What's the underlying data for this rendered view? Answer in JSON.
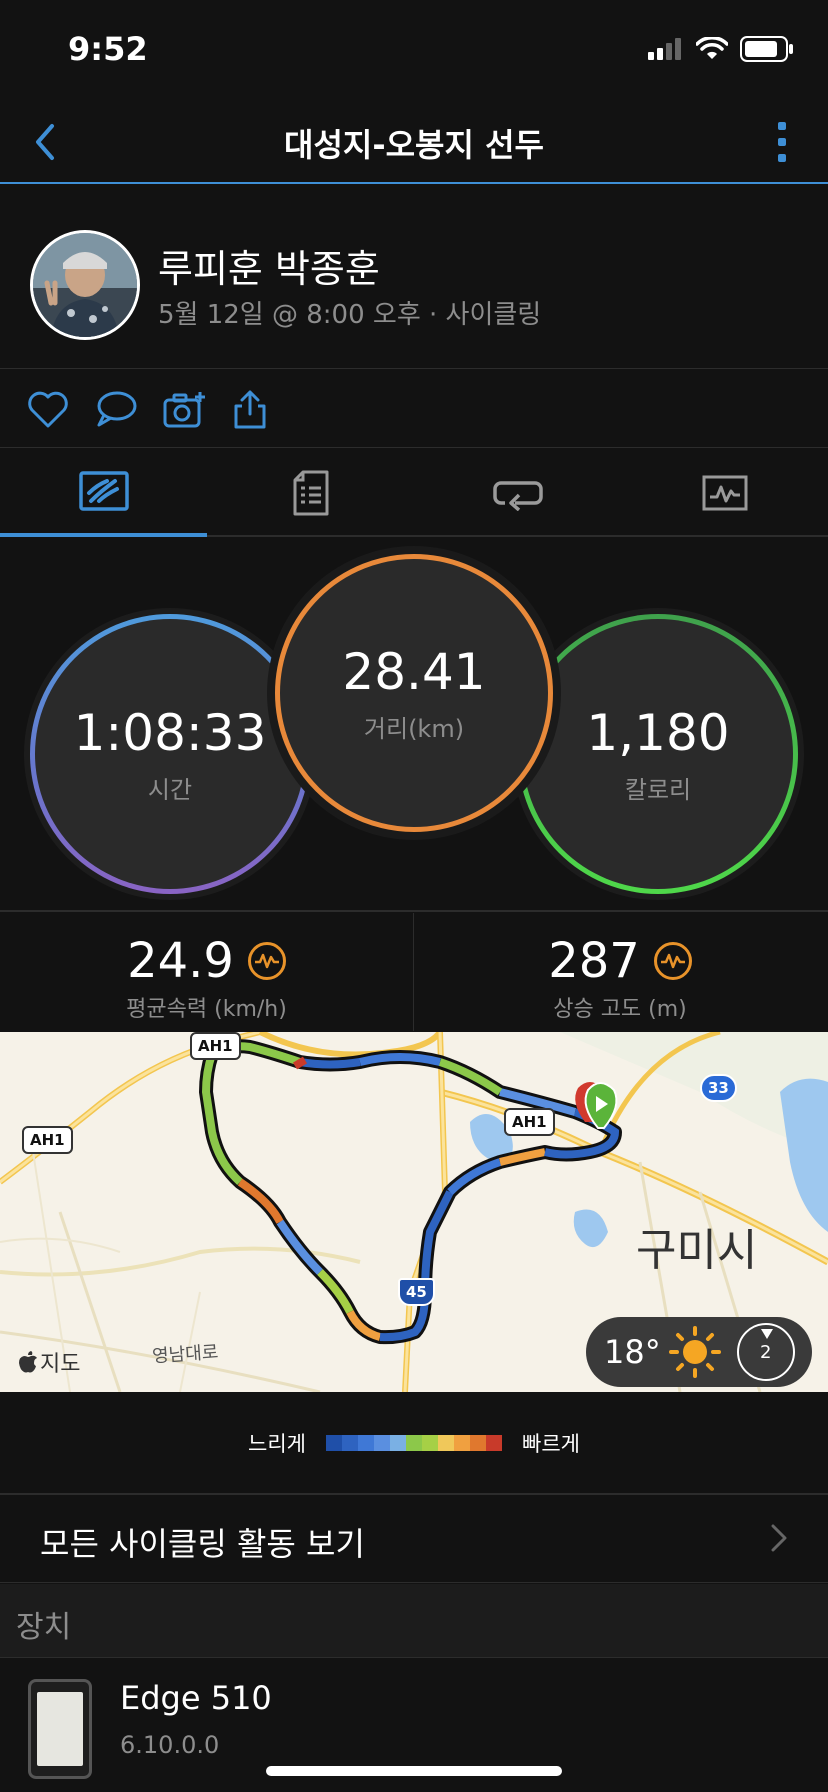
{
  "status": {
    "time": "9:52"
  },
  "nav": {
    "title": "대성지-오봉지 선두"
  },
  "profile": {
    "name": "루피훈 박종훈",
    "subtitle": "5월 12일 @ 8:00 오후 · 사이클링"
  },
  "actions": [
    "like-icon",
    "comment-icon",
    "camera-icon",
    "share-icon"
  ],
  "tabs": [
    {
      "icon": "cycling-summary-icon",
      "active": true
    },
    {
      "icon": "details-document-icon",
      "active": false
    },
    {
      "icon": "laps-icon",
      "active": false
    },
    {
      "icon": "charts-icon",
      "active": false
    }
  ],
  "rings": {
    "time": {
      "value": "1:08:33",
      "label": "시간"
    },
    "distance": {
      "value": "28.41",
      "label": "거리(km)"
    },
    "calories": {
      "value": "1,180",
      "label": "칼로리"
    }
  },
  "stats": {
    "avg_speed": {
      "value": "24.9",
      "label": "평균속력 (km/h)"
    },
    "ascent": {
      "value": "287",
      "label": "상승 고도 (m)"
    }
  },
  "map": {
    "city_label": "구미시",
    "road_label": "영남대로",
    "attribution": "지도",
    "highway_signs": [
      "AH1",
      "AH1",
      "AH1",
      "33",
      "45"
    ],
    "weather": {
      "temp": "18°",
      "wind": "2"
    }
  },
  "legend": {
    "slow": "느리게",
    "fast": "빠르게",
    "colors": [
      "#1f4fa8",
      "#2e63c0",
      "#3f78d6",
      "#5a8fe0",
      "#7ab0e4",
      "#8cc84a",
      "#a6d046",
      "#f0c85a",
      "#f0a040",
      "#e0782e",
      "#c83a2a"
    ]
  },
  "all_activities": {
    "label": "모든 사이클링 활동 보기"
  },
  "devices": {
    "section_title": "장치",
    "name": "Edge 510",
    "version": "6.10.0.0"
  },
  "colors": {
    "accent": "#3e8fd6",
    "ring_distance": "#e8893a",
    "ring_calories": "#4fd84a",
    "ring_time": "#4f9bdc"
  }
}
